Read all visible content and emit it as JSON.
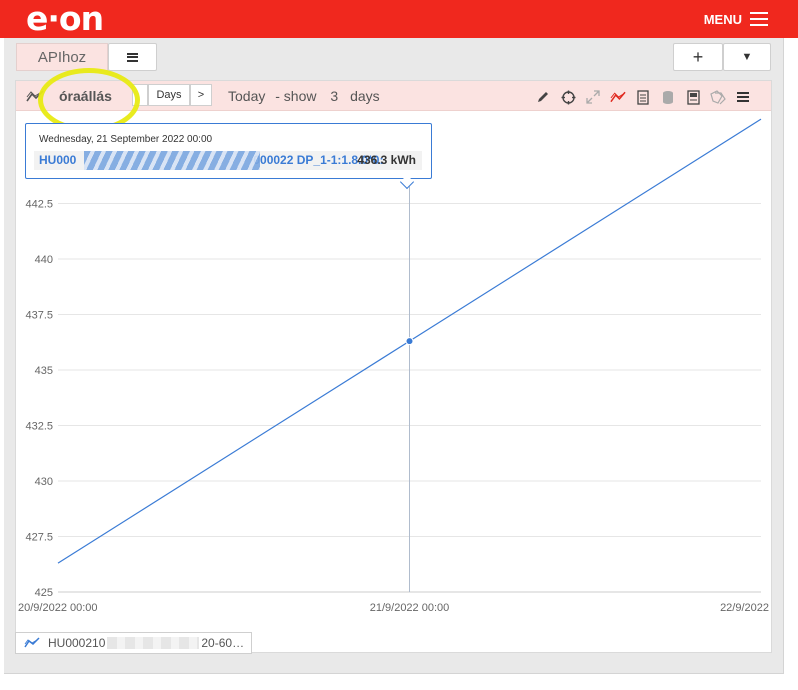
{
  "header": {
    "logo_text": "e·on",
    "menu_label": "MENU",
    "brand_color": "#f0281e"
  },
  "tabs": {
    "active_label": "APIhoz",
    "plus_label": "+",
    "dropdown_label": "▼"
  },
  "card": {
    "title": "óraállás",
    "nav": {
      "prev_label": "",
      "period_label": "Days",
      "next_label": ">"
    },
    "range": {
      "prefix": "Today",
      "show_label": "- show",
      "count": "3",
      "unit": "days"
    },
    "toolbar_icons": [
      "pencil-icon",
      "crosshair-icon",
      "expand-icon",
      "line-chart-icon",
      "document-icon",
      "database-icon",
      "report-icon",
      "tags-icon",
      "menu-icon"
    ]
  },
  "tooltip": {
    "date": "Wednesday, 21 September 2022 00:00",
    "series_start": "HU000",
    "series_end": "000022 DP_1-1:1.8.0*0:",
    "value": "436.3 kWh"
  },
  "legend": {
    "start": "HU000210",
    "end": "20-60…"
  },
  "chart_data": {
    "type": "line",
    "x_tick_labels": [
      "20/9/2022 00:00",
      "21/9/2022 00:00",
      "22/9/2022"
    ],
    "x": [
      0,
      1,
      2
    ],
    "y_ticks": [
      425,
      427.5,
      430,
      432.5,
      435,
      437.5,
      440,
      442.5
    ],
    "y_tick_labels": [
      "425",
      "427.5",
      "430",
      "432.5",
      "435",
      "437.5",
      "440",
      "442.5"
    ],
    "ylim": [
      425,
      445
    ],
    "series": [
      {
        "values": [
          426.3,
          436.3,
          446.3
        ],
        "unit": "kWh",
        "color": "#3a7bd5"
      }
    ],
    "highlight": {
      "x": 1,
      "y": 436.3
    },
    "grid": true
  }
}
